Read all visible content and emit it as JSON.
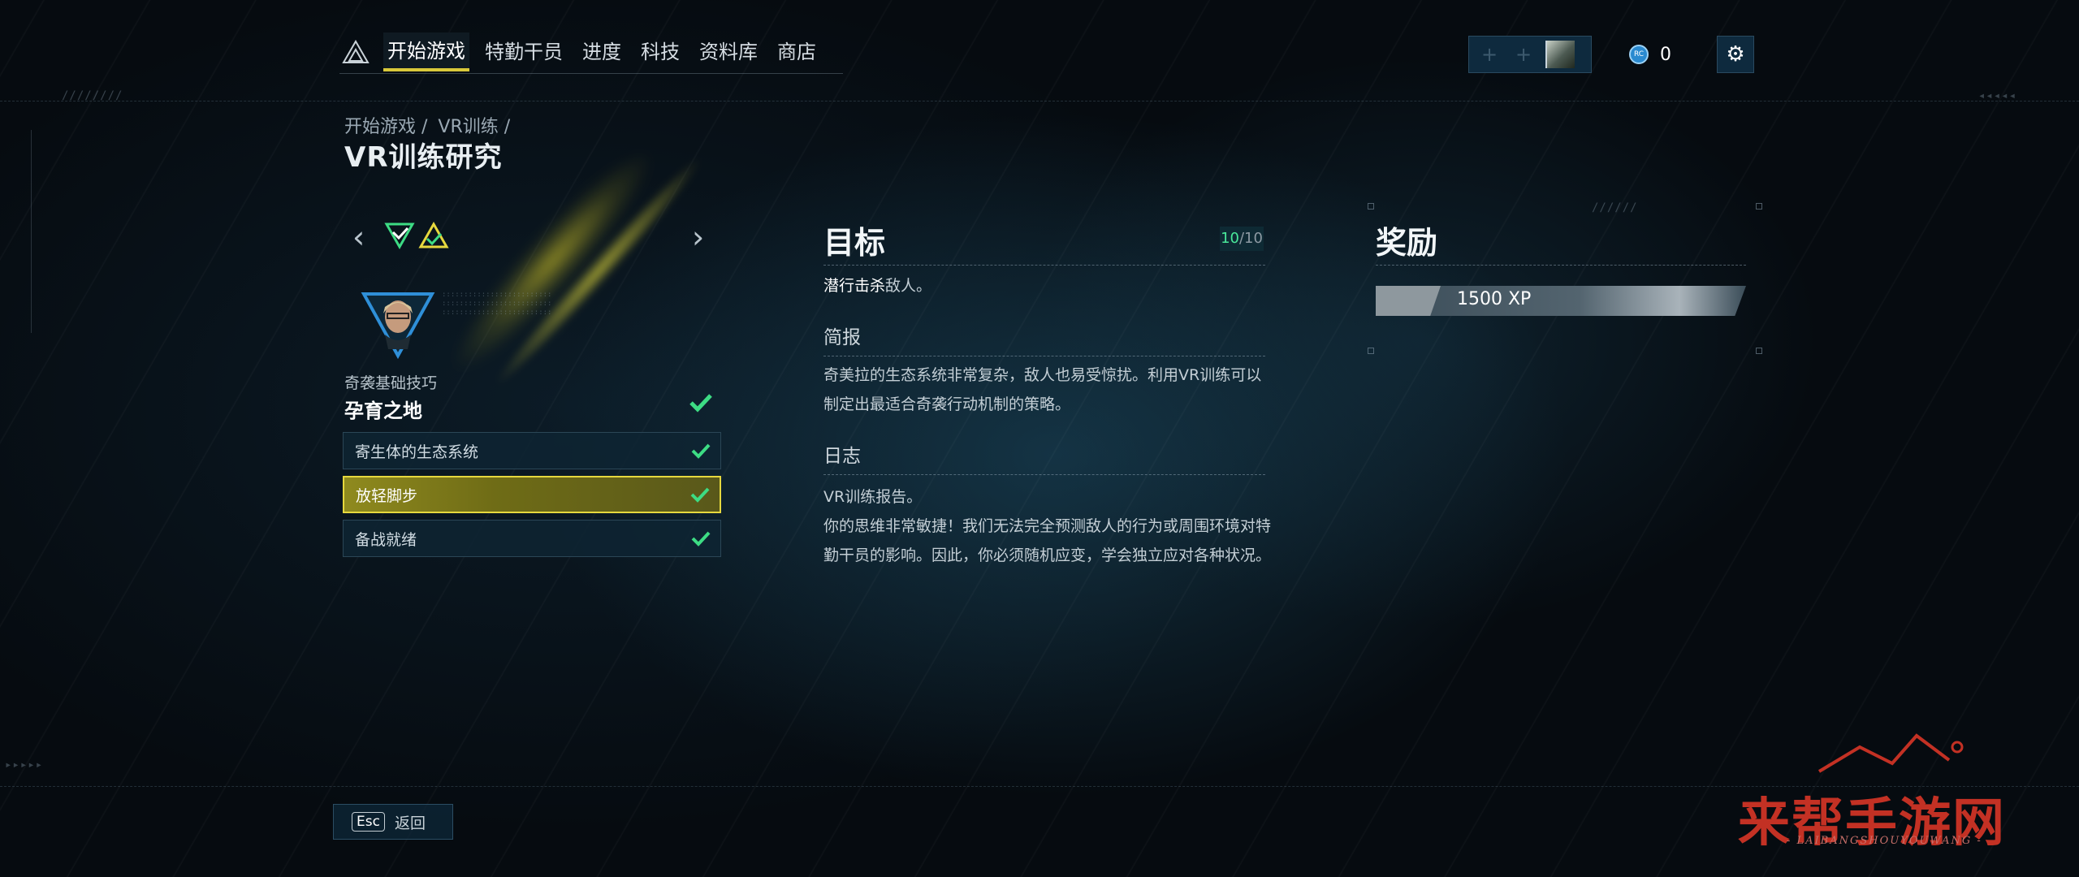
{
  "nav": {
    "tabs": [
      "开始游戏",
      "特勤干员",
      "进度",
      "科技",
      "资料库",
      "商店"
    ],
    "active_index": 0
  },
  "topbar": {
    "currency_icon_text": "RC",
    "currency_value": "0"
  },
  "breadcrumb": [
    "开始游戏 /",
    "VR训练 /"
  ],
  "page_title": "VR训练研究",
  "left_panel": {
    "course_subtitle": "奇袭基础技巧",
    "course_title": "孕育之地",
    "lessons": [
      {
        "label": "寄生体的生态系统",
        "completed": true
      },
      {
        "label": "放轻脚步",
        "completed": true,
        "selected": true
      },
      {
        "label": "备战就绪",
        "completed": true
      }
    ]
  },
  "objective": {
    "heading": "目标",
    "count_done": "10",
    "count_total": "/10",
    "goal_highlight": "潜行击杀",
    "goal_rest": "敌人。",
    "brief_heading": "简报",
    "brief_text": "奇美拉的生态系统非常复杂，敌人也易受惊扰。利用VR训练可以制定出最适合奇袭行动机制的策略。",
    "log_heading": "日志",
    "log_line1": "VR训练报告。",
    "log_line2": "你的思维非常敏捷！我们无法完全预测敌人的行为或周围环境对特勤干员的影响。因此，你必须随机应变，学会独立应对各种状况。"
  },
  "rewards": {
    "heading": "奖励",
    "xp": "1500 XP"
  },
  "footer": {
    "key": "Esc",
    "back_label": "返回"
  },
  "watermark": {
    "main": "来帮手游网",
    "sub": "- LAIBANGSHOUYOUWANG -"
  },
  "colors": {
    "accent_yellow": "#e6d83e",
    "check_green": "#3ddc84",
    "count_green": "#49e89a"
  }
}
